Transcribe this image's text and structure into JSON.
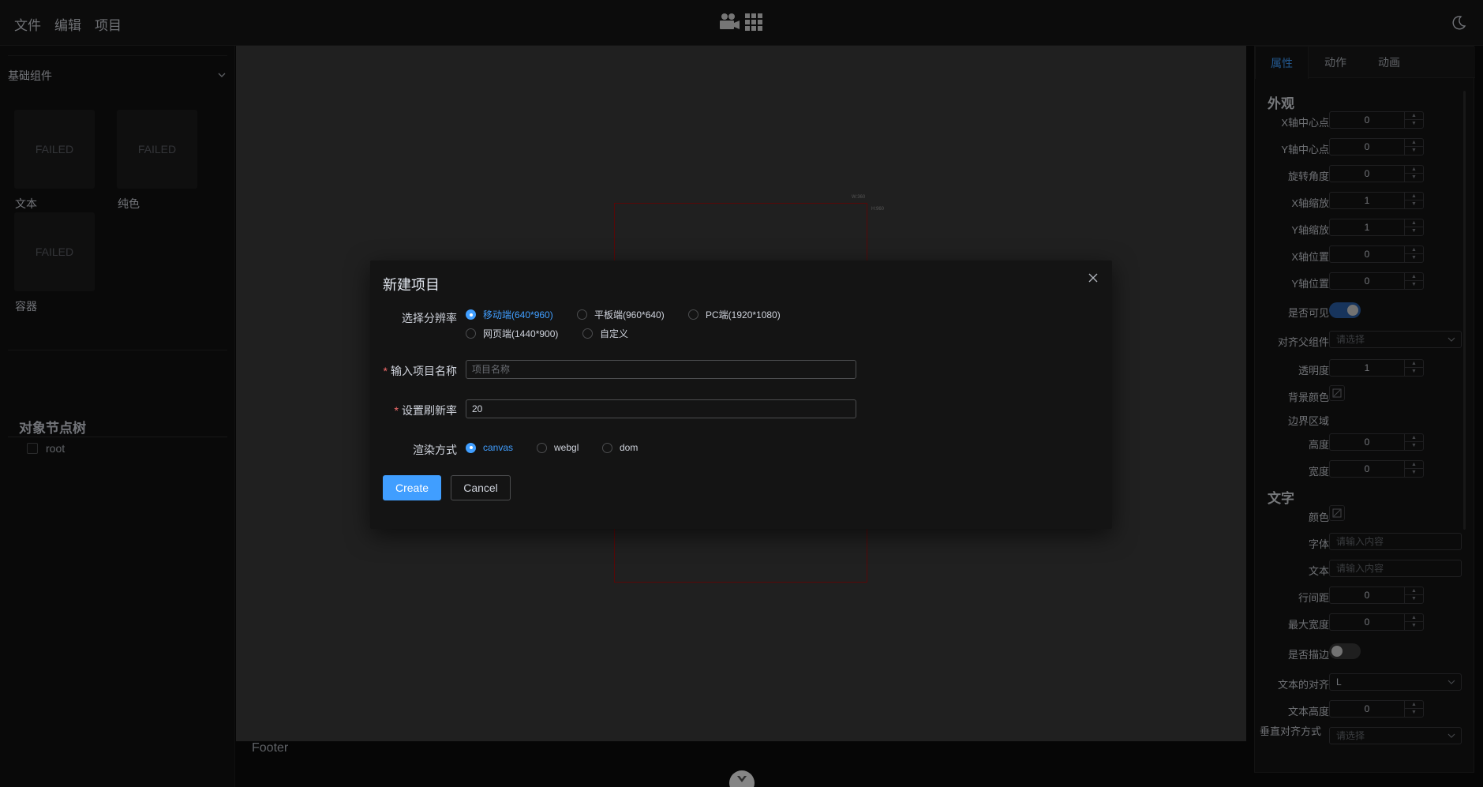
{
  "menu": [
    "文件",
    "编辑",
    "项目"
  ],
  "left": {
    "group_title": "基础组件",
    "cards": [
      {
        "thumb": "FAILED",
        "label": "文本"
      },
      {
        "thumb": "FAILED",
        "label": "纯色"
      },
      {
        "thumb": "FAILED",
        "label": "容器"
      }
    ],
    "tree_title": "对象节点树",
    "tree_root": "root"
  },
  "canvas": {
    "mark_w": "W:360",
    "mark_h": "H:960",
    "footer": "Footer"
  },
  "right": {
    "tabs": [
      "属性",
      "动作",
      "动画"
    ],
    "section_appearance": "外观",
    "section_text": "文字",
    "props": {
      "x_center": {
        "label": "X轴中心点",
        "value": "0"
      },
      "y_center": {
        "label": "Y轴中心点",
        "value": "0"
      },
      "rotation": {
        "label": "旋转角度",
        "value": "0"
      },
      "x_scale": {
        "label": "X轴缩放",
        "value": "1"
      },
      "y_scale": {
        "label": "Y轴缩放",
        "value": "1"
      },
      "x_pos": {
        "label": "X轴位置",
        "value": "0"
      },
      "y_pos": {
        "label": "Y轴位置",
        "value": "0"
      },
      "visible": {
        "label": "是否可见"
      },
      "align_parent": {
        "label": "对齐父组件",
        "placeholder": "请选择"
      },
      "opacity": {
        "label": "透明度",
        "value": "1"
      },
      "bg_color": {
        "label": "背景颜色"
      },
      "bounds": {
        "label": "边界区域"
      },
      "height": {
        "label": "高度",
        "value": "0"
      },
      "width": {
        "label": "宽度",
        "value": "0"
      },
      "color": {
        "label": "颜色"
      },
      "font": {
        "label": "字体",
        "placeholder": "请输入内容"
      },
      "text": {
        "label": "文本",
        "placeholder": "请输入内容"
      },
      "line_spacing": {
        "label": "行间距",
        "value": "0"
      },
      "max_width": {
        "label": "最大宽度",
        "value": "0"
      },
      "stroke": {
        "label": "是否描边"
      },
      "text_align": {
        "label": "文本的对齐",
        "value": "L"
      },
      "text_height": {
        "label": "文本高度",
        "value": "0"
      },
      "valign": {
        "label": "垂直对齐方式",
        "placeholder": "请选择"
      }
    }
  },
  "dialog": {
    "title": "新建项目",
    "resolution_label": "选择分辨率",
    "resolutions": [
      "移动端(640*960)",
      "平板端(960*640)",
      "PC端(1920*1080)",
      "网页端(1440*900)",
      "自定义"
    ],
    "selected_resolution": "移动端(640*960)",
    "name_label": "输入项目名称",
    "name_placeholder": "项目名称",
    "fps_label": "设置刷新率",
    "fps_value": "20",
    "render_label": "渲染方式",
    "render_modes": [
      "canvas",
      "webgl",
      "dom"
    ],
    "selected_render": "canvas",
    "create": "Create",
    "cancel": "Cancel"
  },
  "colors": {
    "accent": "#409eff",
    "stage_border": "#a01010",
    "required": "#f56c6c"
  }
}
